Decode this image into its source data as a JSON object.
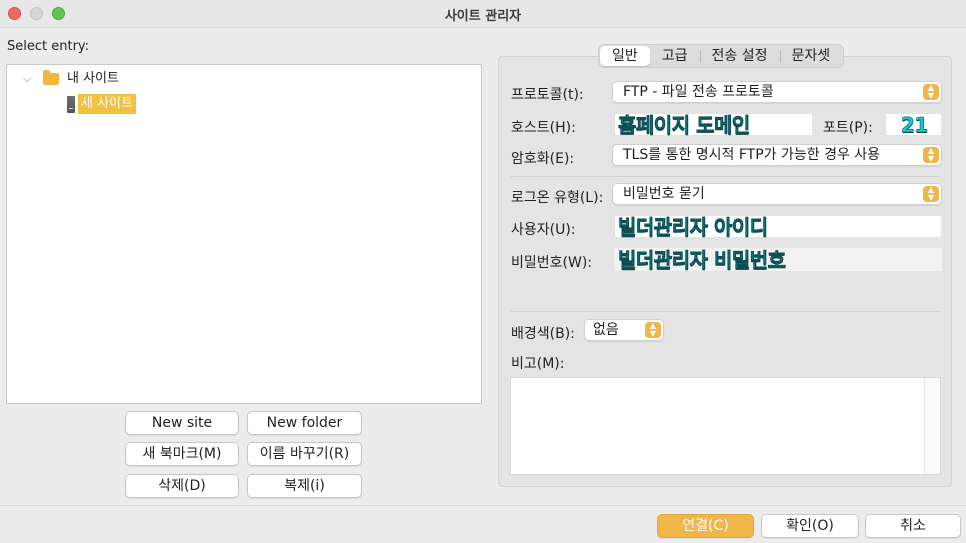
{
  "window": {
    "title": "사이트 관리자"
  },
  "left": {
    "select_label": "Select entry:",
    "tree": [
      {
        "label": "내 사이트",
        "icon": "folder-icon",
        "expanded": true
      },
      {
        "label": "새 사이트",
        "icon": "server-icon",
        "selected": true
      }
    ],
    "buttons": {
      "new_site": "New site",
      "new_folder": "New folder",
      "new_bookmark": "새 북마크(M)",
      "rename": "이름 바꾸기(R)",
      "delete": "삭제(D)",
      "duplicate": "복제(i)"
    }
  },
  "tabs": [
    {
      "label": "일반",
      "active": true
    },
    {
      "label": "고급"
    },
    {
      "label": "전송 설정"
    },
    {
      "label": "문자셋"
    }
  ],
  "general": {
    "protocol_label": "프로토콜(t):",
    "protocol_value": "FTP - 파일 전송 프로토콜",
    "host_label": "호스트(H):",
    "host_value": "홈페이지 도메인",
    "port_label": "포트(P):",
    "port_value": "21",
    "encryption_label": "암호화(E):",
    "encryption_value": "TLS를 통한 명시적 FTP가 가능한 경우 사용",
    "logon_label": "로그온 유형(L):",
    "logon_value": "비밀번호 묻기",
    "user_label": "사용자(U):",
    "user_value": "빌더관리자 아이디",
    "password_label": "비밀번호(W):",
    "password_value": "빌더관리자 비밀번호",
    "bgcolor_label": "배경색(B):",
    "bgcolor_value": "없음",
    "memo_label": "비고(M):",
    "memo_value": ""
  },
  "footer": {
    "connect": "연결(C)",
    "ok": "확인(O)",
    "cancel": "취소"
  },
  "colors": {
    "accent": "#f0b64a",
    "selection": "#f5c042",
    "annotation_text": "#14c9d4"
  }
}
